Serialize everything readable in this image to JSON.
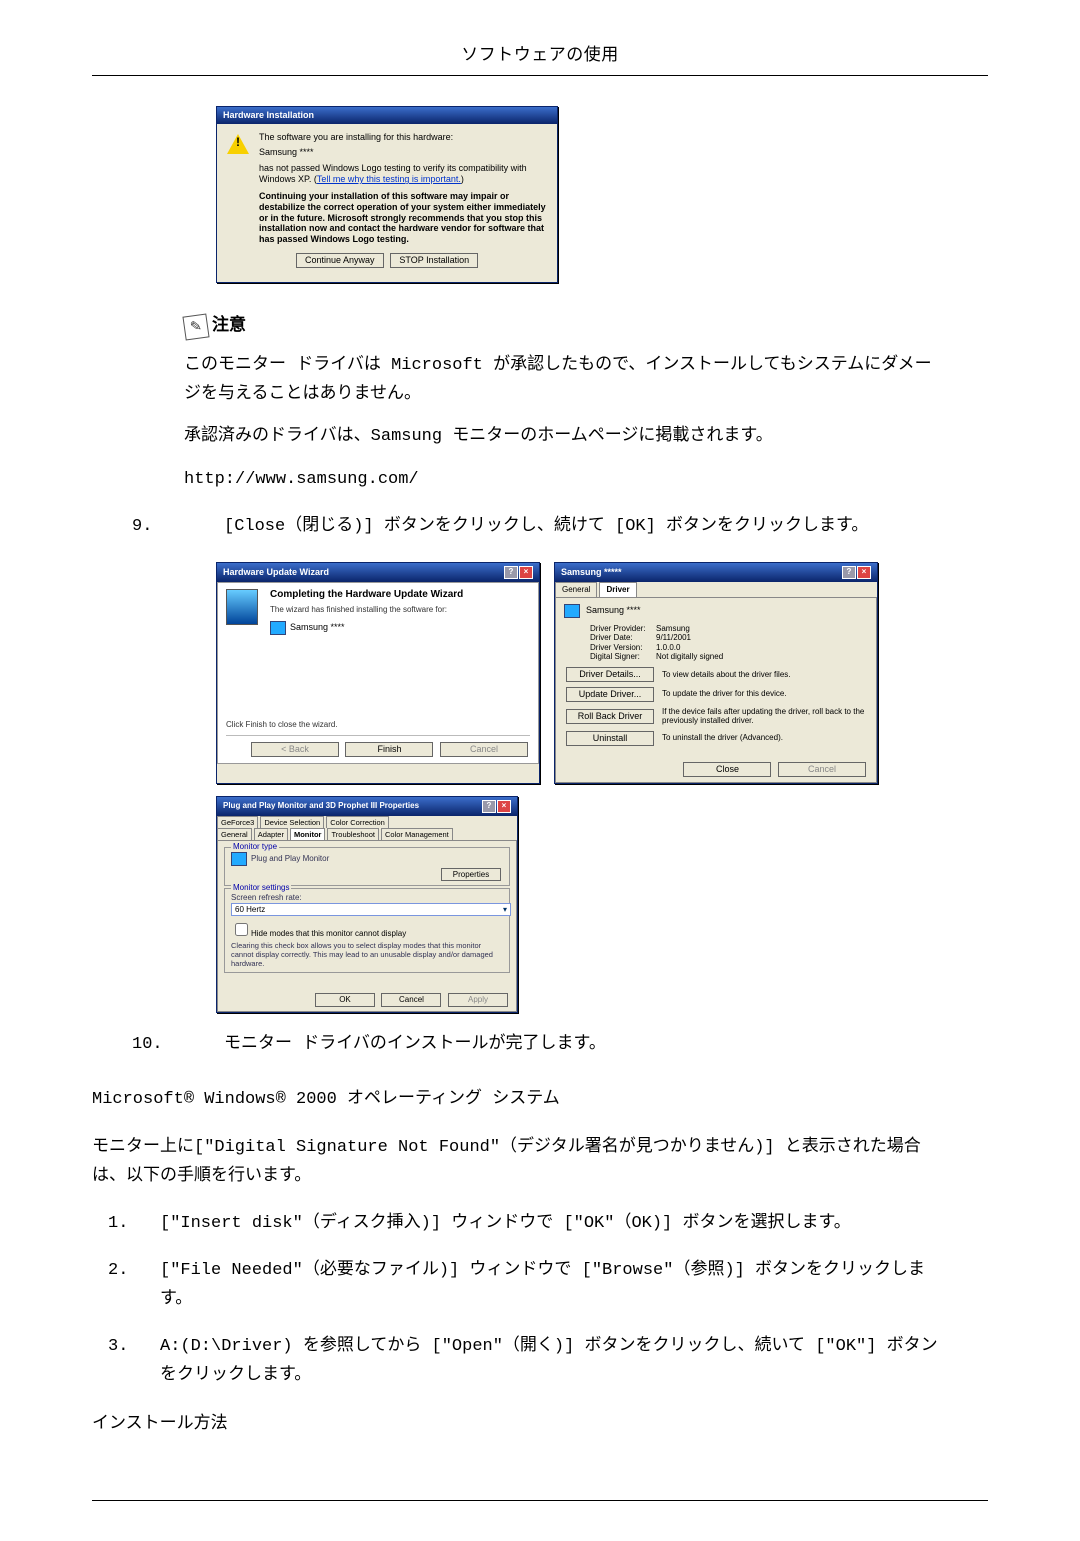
{
  "page_title": "ソフトウェアの使用",
  "hwinst": {
    "title": "Hardware Installation",
    "l1": "The software you are installing for this hardware:",
    "device": "Samsung ****",
    "l2a": "has not passed Windows Logo testing to verify its compatibility with Windows XP. (",
    "link": "Tell me why this testing is important.",
    "l2b": ")",
    "bold": "Continuing your installation of this software may impair or destabilize the correct operation of your system either immediately or in the future. Microsoft strongly recommends that you stop this installation now and contact the hardware vendor for software that has passed Windows Logo testing.",
    "btn_continue": "Continue Anyway",
    "btn_stop": "STOP Installation"
  },
  "notice_label": "注意",
  "notice_p1": "このモニター ドライバは Microsoft が承認したもので、インストールしてもシステムにダメージを与えることはありません。",
  "notice_p2": "承認済みのドライバは、Samsung モニターのホームページに掲載されます。",
  "notice_url": "http://www.samsung.com/",
  "step9_num": "9.",
  "step9": "[Close（閉じる)] ボタンをクリックし、続けて [OK] ボタンをクリックします。",
  "wiz": {
    "title": "Hardware Update Wizard",
    "head": "Completing the Hardware Update Wizard",
    "sub1": "The wizard has finished installing the software for:",
    "device": "Samsung ****",
    "sub2": "Click Finish to close the wizard.",
    "back": "< Back",
    "finish": "Finish",
    "cancel": "Cancel"
  },
  "props": {
    "title": "Samsung *****",
    "tab_general": "General",
    "tab_driver": "Driver",
    "device": "Samsung ****",
    "provider_k": "Driver Provider:",
    "provider_v": "Samsung",
    "date_k": "Driver Date:",
    "date_v": "9/11/2001",
    "ver_k": "Driver Version:",
    "ver_v": "1.0.0.0",
    "sign_k": "Digital Signer:",
    "sign_v": "Not digitally signed",
    "btn_details": "Driver Details...",
    "btn_details_d": "To view details about the driver files.",
    "btn_update": "Update Driver...",
    "btn_update_d": "To update the driver for this device.",
    "btn_rollback": "Roll Back Driver",
    "btn_rollback_d": "If the device fails after updating the driver, roll back to the previously installed driver.",
    "btn_uninstall": "Uninstall",
    "btn_uninstall_d": "To uninstall the driver (Advanced).",
    "close": "Close",
    "cancel": "Cancel"
  },
  "monprops": {
    "title": "Plug and Play Monitor and 3D Prophet III Properties",
    "t1": "GeForce3",
    "t2": "Device Selection",
    "t3": "Color Correction",
    "t4": "General",
    "t5": "Adapter",
    "t6": "Monitor",
    "t7": "Troubleshoot",
    "t8": "Color Management",
    "grp1": "Monitor type",
    "mon": "Plug and Play Monitor",
    "btn_props": "Properties",
    "grp2": "Monitor settings",
    "rate_lbl": "Screen refresh rate:",
    "rate_val": "60 Hertz",
    "hide": "Hide modes that this monitor cannot display",
    "hide_note": "Clearing this check box allows you to select display modes that this monitor cannot display correctly. This may lead to an unusable display and/or damaged hardware.",
    "ok": "OK",
    "cancel": "Cancel",
    "apply": "Apply"
  },
  "step10_num": "10.",
  "step10": "モニター ドライバのインストールが完了します。",
  "os_line": "Microsoft® Windows® 2000 オペレーティング システム",
  "dsig_para": "モニター上に[\"Digital Signature Not Found\"（デジタル署名が見つかりません)] と表示された場合は、以下の手順を行います。",
  "s1_num": "1.",
  "s1": "[\"Insert disk\"（ディスク挿入)] ウィンドウで [\"OK\"（OK)] ボタンを選択します。",
  "s2_num": "2.",
  "s2": "[\"File Needed\"（必要なファイル)] ウィンドウで [\"Browse\"（参照)] ボタンをクリックします。",
  "s3_num": "3.",
  "s3": "A:(D:\\Driver) を参照してから [\"Open\"（開く)] ボタンをクリックし、続いて [\"OK\"] ボタンをクリックします。",
  "install_head": "インストール方法"
}
